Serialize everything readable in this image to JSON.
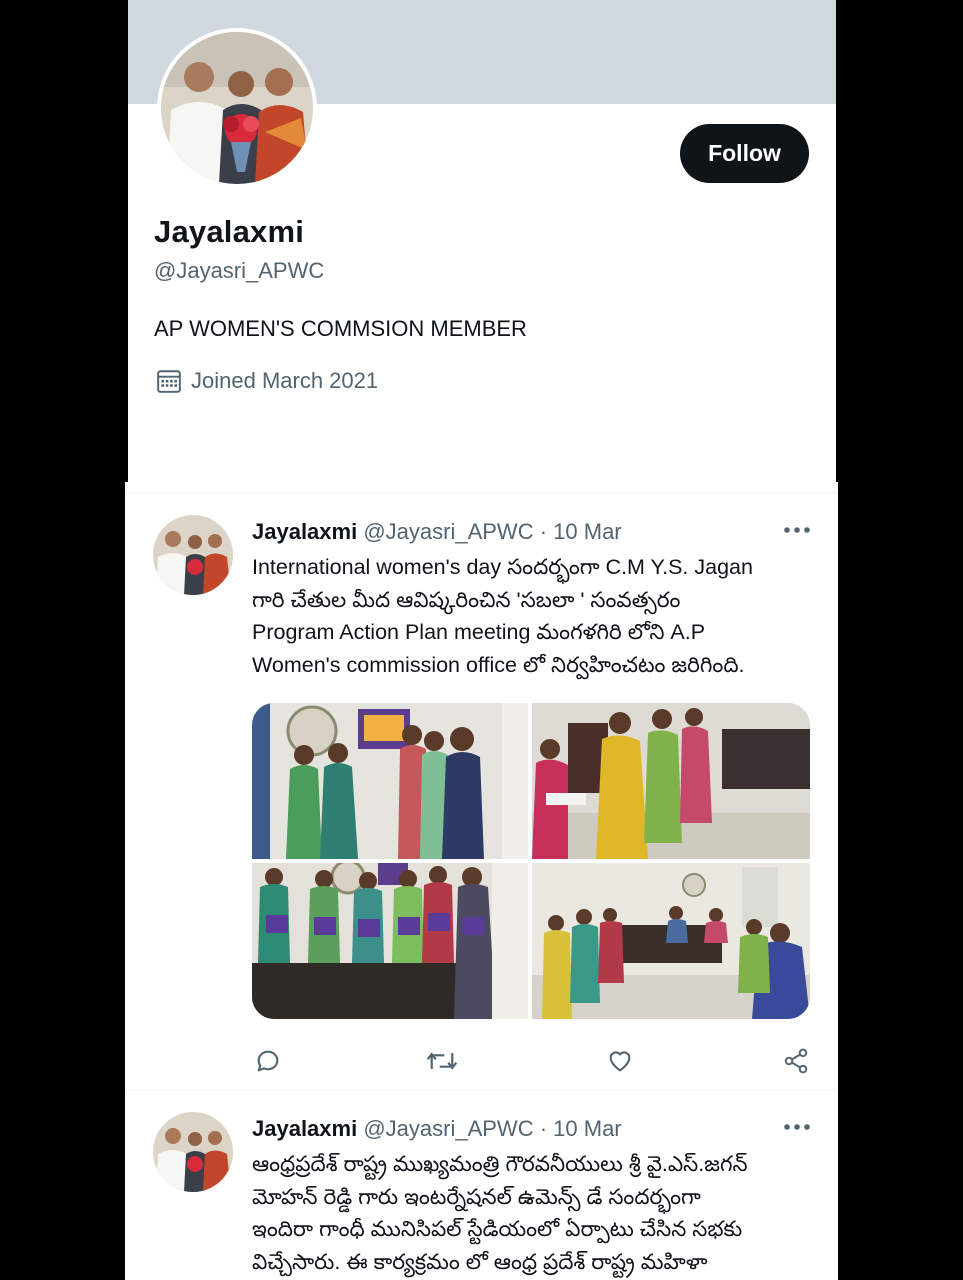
{
  "profile": {
    "name": "Jayalaxmi",
    "handle": "@Jayasri_APWC",
    "bio": "AP WOMEN'S COMMSION MEMBER",
    "joined": "Joined March 2021",
    "follow_label": "Follow"
  },
  "tweets": [
    {
      "name": "Jayalaxmi",
      "handle": "@Jayasri_APWC",
      "date": "· 10 Mar",
      "lines": [
        "International women's day సందర్భంగా C.M Y.S. Jagan",
        "గారి చేతుల మీద ఆవిష్కరించిన 'సబలా ' సంవత్సరం",
        "Program Action Plan meeting మంగళగిరి లోని A.P",
        "Women's commission office లో నిర్వహించటం జరిగింది."
      ]
    },
    {
      "name": "Jayalaxmi",
      "handle": "@Jayasri_APWC",
      "date": "· 10 Mar",
      "lines": [
        "ఆంధ్రప్రదేశ్ రాష్ట్ర ముఖ్యమంత్రి గౌరవనీయులు శ్రీ వై.ఎస్.జగన్",
        "మోహన్ రెడ్డి గారు ఇంటర్నేషనల్ ఉమెన్స్ డే సందర్భంగా",
        "ఇందిరా గాంధీ మునిసిపల్ స్టేడియంలో ఏర్పాటు చేసిన సభకు",
        "విచ్చేసారు. ఈ కార్యక్రమం లో ఆంధ్ర ప్రదేశ్ రాష్ట్ర మహిళా"
      ]
    }
  ],
  "colors": {
    "banner": "#cfd9de",
    "text": "#0f1419",
    "secondary": "#536471",
    "button": "#0f1419"
  }
}
